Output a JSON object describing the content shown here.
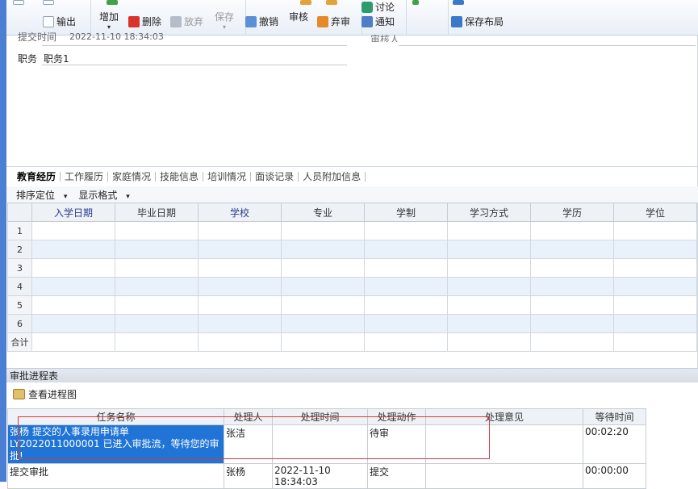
{
  "toolbar": {
    "output_label": "输出",
    "add_label": "增加",
    "delete_label": "删除",
    "abandon_label": "放弃",
    "save_label": "保存",
    "undo_label": "撤销",
    "review_label": "审核",
    "discard_label": "弃审",
    "discuss_label": "讨论",
    "notify_label": "通知",
    "save_layout_label": "保存布局"
  },
  "form": {
    "submit_time_label": "提交时间",
    "submit_time_value": "2022-11-10 18:34:03",
    "reviewer_label": "审核人",
    "position_label": "职务",
    "position_value": "职务1"
  },
  "tabs": [
    "教育经历",
    "工作履历",
    "家庭情况",
    "技能信息",
    "培训情况",
    "面谈记录",
    "人员附加信息"
  ],
  "subbar": {
    "sort_label": "排序定位",
    "format_label": "显示格式"
  },
  "grid": {
    "columns": [
      "入学日期",
      "毕业日期",
      "学校",
      "专业",
      "学制",
      "学习方式",
      "学历",
      "学位"
    ],
    "row_numbers": [
      "1",
      "2",
      "3",
      "4",
      "5",
      "6"
    ],
    "total_label": "合计"
  },
  "process": {
    "title": "审批进程表",
    "view_progress_label": "查看进程图",
    "columns": [
      "任务名称",
      "处理人",
      "处理时间",
      "处理动作",
      "处理意见",
      "等待时间"
    ],
    "rows": [
      {
        "task": "张杨 提交的人事录用申请单 LY2022011000001 已进入审批流，等待您的审批!",
        "handler": "张洁",
        "time": "",
        "action": "待审",
        "opinion": "",
        "wait": "00:02:20"
      },
      {
        "task": "提交审批",
        "handler": "张杨",
        "time": "2022-11-10 18:34:03",
        "action": "提交",
        "opinion": "",
        "wait": "00:00:00"
      }
    ]
  }
}
